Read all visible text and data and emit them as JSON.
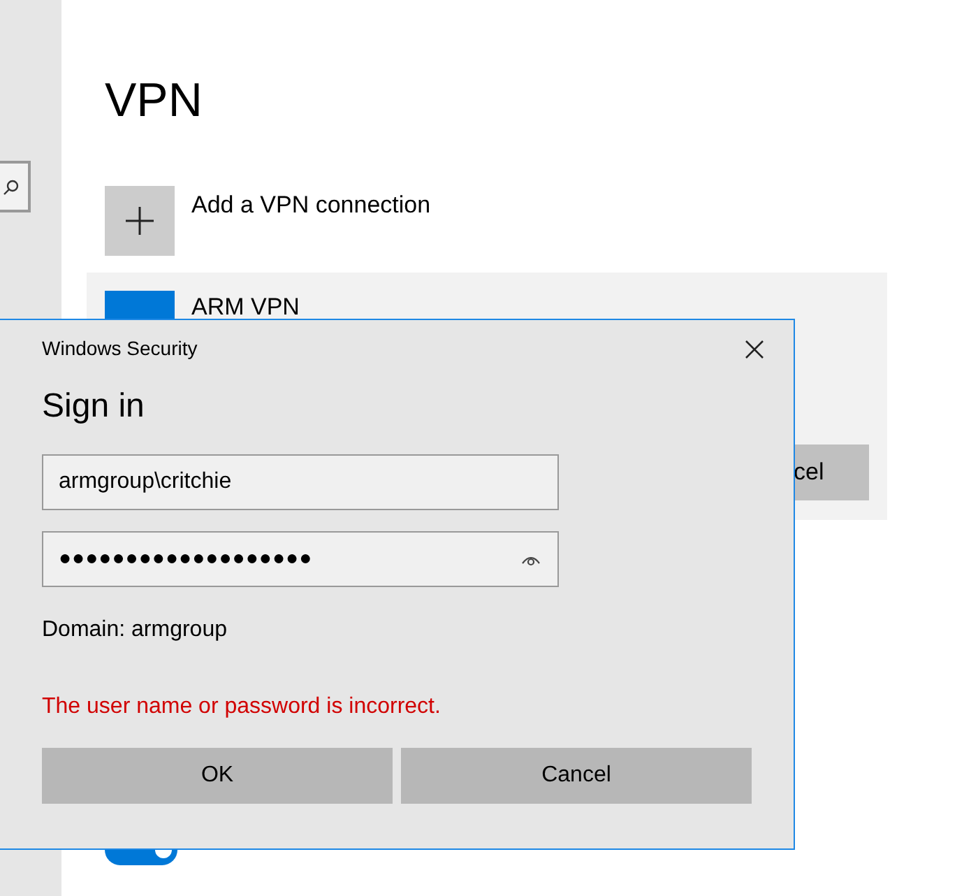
{
  "page": {
    "title": "VPN"
  },
  "add_connection": {
    "label": "Add a VPN connection"
  },
  "connections": [
    {
      "name": "ARM VPN",
      "cancel_button": "cel"
    }
  ],
  "toggle": {
    "on": true
  },
  "dialog": {
    "title": "Windows Security",
    "heading": "Sign in",
    "username": "armgroup\\critchie",
    "password_mask": "●●●●●●●●●●●●●●●●●●●",
    "domain": "Domain: armgroup",
    "error": "The user name or password is incorrect.",
    "buttons": [
      "OK",
      "Cancel"
    ]
  }
}
